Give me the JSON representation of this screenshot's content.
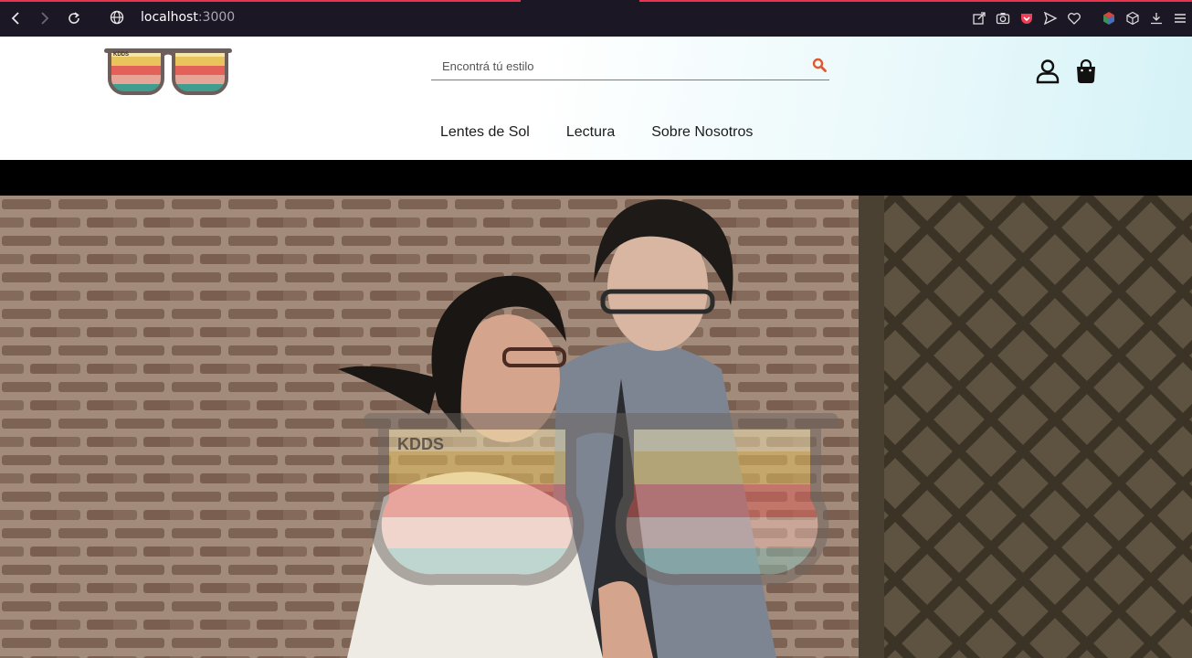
{
  "browser": {
    "url_host": "localhost",
    "url_port": ":3000",
    "nav_icons": [
      "back-icon",
      "forward-icon",
      "reload-icon",
      "globe-icon"
    ],
    "toolbar_icons": [
      "share-icon",
      "camera-icon",
      "pocket-icon",
      "send-icon",
      "heart-icon",
      "extension-icon",
      "cube-icon",
      "download-icon",
      "menu-icon"
    ],
    "accent": "#e8344e",
    "background": "#1b1725"
  },
  "header": {
    "logo_text": "KDDS",
    "search": {
      "placeholder": "Encontrá tú estilo",
      "accent": "#e4572e"
    },
    "menu": [
      {
        "label": "Lentes de Sol"
      },
      {
        "label": "Lectura"
      },
      {
        "label": "Sobre Nosotros"
      }
    ]
  },
  "hero": {
    "watermark_text": "KDDS",
    "stripe_colors": [
      "#e9c35c",
      "#e2625a",
      "#e6b3a8",
      "#7fb6b0"
    ]
  }
}
